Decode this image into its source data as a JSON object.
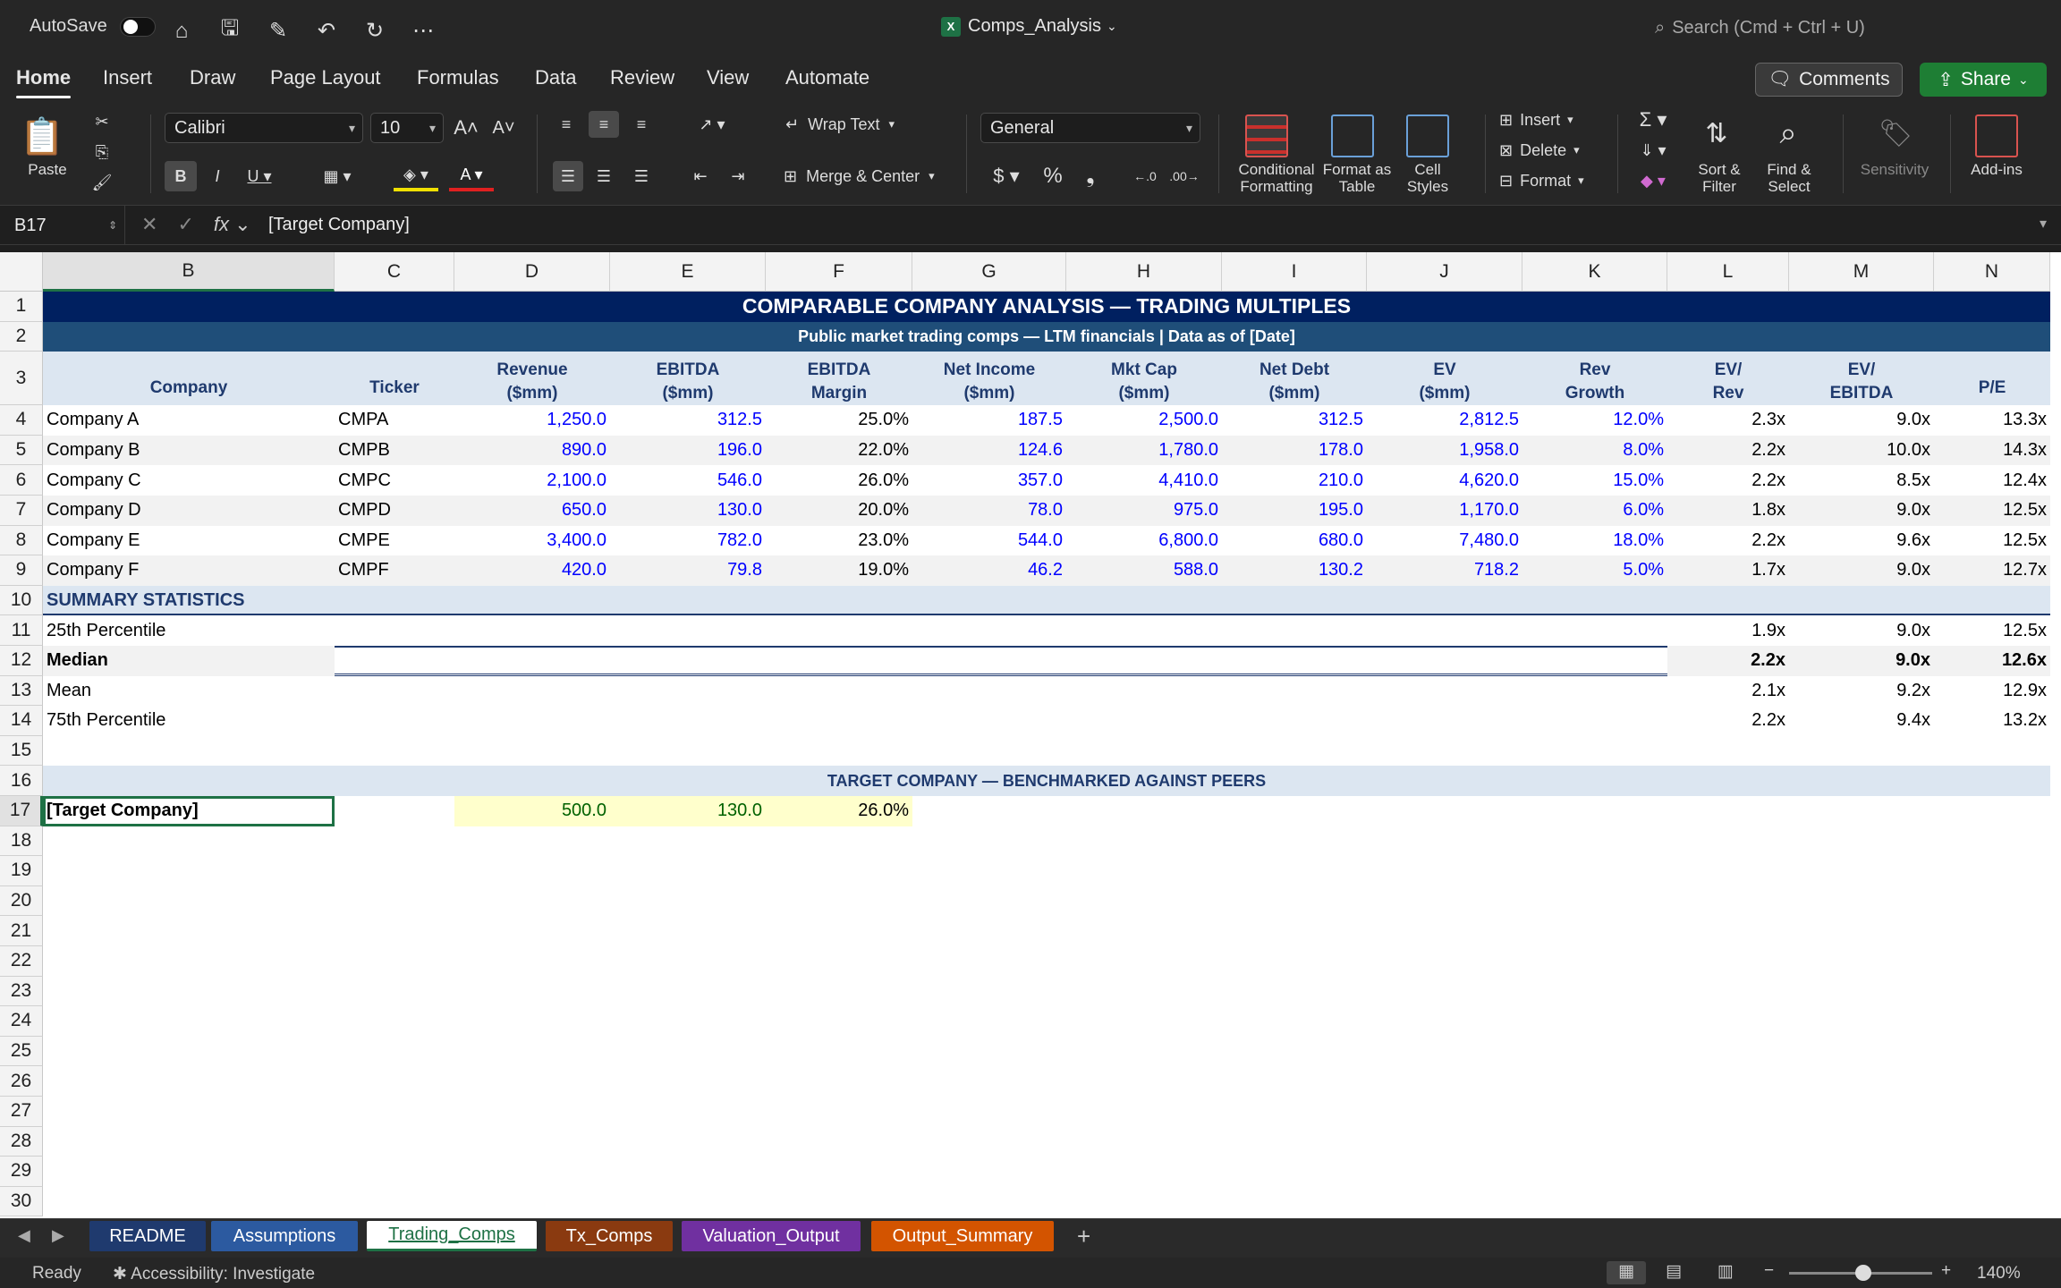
{
  "titlebar": {
    "autosave_label": "AutoSave",
    "doc_title": "Comps_Analysis",
    "search_placeholder": "Search (Cmd + Ctrl + U)"
  },
  "menu": [
    "Home",
    "Insert",
    "Draw",
    "Page Layout",
    "Formulas",
    "Data",
    "Review",
    "View",
    "Automate"
  ],
  "buttons": {
    "comments": "Comments",
    "share": "Share"
  },
  "ribbon": {
    "paste": "Paste",
    "font_name": "Calibri",
    "font_size": "10",
    "wrap_text": "Wrap Text",
    "merge_center": "Merge & Center",
    "number_format": "General",
    "conditional_formatting": "Conditional Formatting",
    "format_as_table": "Format as Table",
    "cell_styles": "Cell Styles",
    "insert": "Insert",
    "delete": "Delete",
    "format": "Format",
    "sort_filter": "Sort & Filter",
    "find_select": "Find & Select",
    "sensitivity": "Sensitivity",
    "addins": "Add-ins"
  },
  "formula_bar": {
    "name_box": "B17",
    "value": "[Target Company]"
  },
  "columns": [
    "B",
    "C",
    "D",
    "E",
    "F",
    "G",
    "H",
    "I",
    "J",
    "K",
    "L",
    "M",
    "N"
  ],
  "rows": [
    "1",
    "2",
    "3",
    "4",
    "5",
    "6",
    "7",
    "8",
    "9",
    "10",
    "11",
    "12",
    "13",
    "14",
    "15",
    "16",
    "17",
    "18",
    "19",
    "20",
    "21",
    "22",
    "23",
    "24",
    "25",
    "26",
    "27",
    "28",
    "29",
    "30"
  ],
  "sheet": {
    "title": "COMPARABLE COMPANY ANALYSIS — TRADING MULTIPLES",
    "subtitle": "Public market trading comps — LTM financials | Data as of [Date]",
    "headers": [
      [
        "Company"
      ],
      [
        "Ticker"
      ],
      [
        "Revenue",
        "($mm)"
      ],
      [
        "EBITDA",
        "($mm)"
      ],
      [
        "EBITDA",
        "Margin"
      ],
      [
        "Net Income",
        "($mm)"
      ],
      [
        "Mkt Cap",
        "($mm)"
      ],
      [
        "Net Debt",
        "($mm)"
      ],
      [
        "EV",
        "($mm)"
      ],
      [
        "Rev",
        "Growth"
      ],
      [
        "EV/",
        "Rev"
      ],
      [
        "EV/",
        "EBITDA"
      ],
      [
        "P/E"
      ]
    ],
    "companies": [
      [
        "Company A",
        "CMPA",
        "1,250.0",
        "312.5",
        "25.0%",
        "187.5",
        "2,500.0",
        "312.5",
        "2,812.5",
        "12.0%",
        "2.3x",
        "9.0x",
        "13.3x"
      ],
      [
        "Company B",
        "CMPB",
        "890.0",
        "196.0",
        "22.0%",
        "124.6",
        "1,780.0",
        "178.0",
        "1,958.0",
        "8.0%",
        "2.2x",
        "10.0x",
        "14.3x"
      ],
      [
        "Company C",
        "CMPC",
        "2,100.0",
        "546.0",
        "26.0%",
        "357.0",
        "4,410.0",
        "210.0",
        "4,620.0",
        "15.0%",
        "2.2x",
        "8.5x",
        "12.4x"
      ],
      [
        "Company D",
        "CMPD",
        "650.0",
        "130.0",
        "20.0%",
        "78.0",
        "975.0",
        "195.0",
        "1,170.0",
        "6.0%",
        "1.8x",
        "9.0x",
        "12.5x"
      ],
      [
        "Company E",
        "CMPE",
        "3,400.0",
        "782.0",
        "23.0%",
        "544.0",
        "6,800.0",
        "680.0",
        "7,480.0",
        "18.0%",
        "2.2x",
        "9.6x",
        "12.5x"
      ],
      [
        "Company F",
        "CMPF",
        "420.0",
        "79.8",
        "19.0%",
        "46.2",
        "588.0",
        "130.2",
        "718.2",
        "5.0%",
        "1.7x",
        "9.0x",
        "12.7x"
      ]
    ],
    "summary_label": "SUMMARY STATISTICS",
    "stats": [
      [
        "25th Percentile",
        "1.9x",
        "9.0x",
        "12.5x"
      ],
      [
        "Median",
        "2.2x",
        "9.0x",
        "12.6x"
      ],
      [
        "Mean",
        "2.1x",
        "9.2x",
        "12.9x"
      ],
      [
        "75th Percentile",
        "2.2x",
        "9.4x",
        "13.2x"
      ]
    ],
    "benchmark_label": "TARGET COMPANY — BENCHMARKED AGAINST PEERS",
    "target": {
      "name": "[Target Company]",
      "revenue": "500.0",
      "ebitda": "130.0",
      "margin": "26.0%"
    }
  },
  "tabs": [
    {
      "label": "README",
      "color": "#1f3a6e"
    },
    {
      "label": "Assumptions",
      "color": "#2c5aa0"
    },
    {
      "label": "Trading_Comps",
      "color": "#ffffff"
    },
    {
      "label": "Tx_Comps",
      "color": "#8a3a10"
    },
    {
      "label": "Valuation_Output",
      "color": "#7030a0"
    },
    {
      "label": "Output_Summary",
      "color": "#d35400"
    }
  ],
  "status": {
    "ready": "Ready",
    "accessibility": "Accessibility: Investigate",
    "zoom": "140%"
  }
}
